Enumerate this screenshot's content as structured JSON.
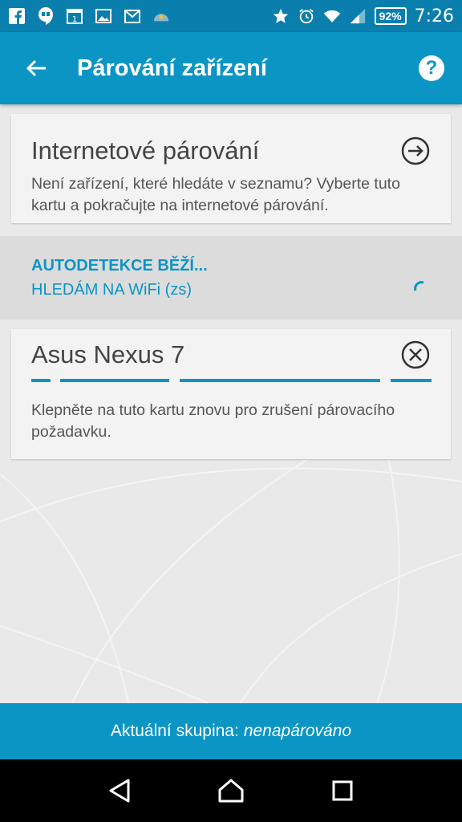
{
  "status_bar": {
    "time": "7:26",
    "battery": "92%",
    "notification_icons": [
      "facebook-icon",
      "hangouts-icon",
      "calendar-icon",
      "gallery-icon",
      "gmail-icon",
      "weather-icon"
    ],
    "system_icons": [
      "star-icon",
      "alarm-icon",
      "wifi-icon",
      "signal-icon"
    ]
  },
  "app_bar": {
    "title": "Párování zařízení",
    "help_label": "?"
  },
  "internet_card": {
    "title": "Internetové párování",
    "description": "Není zařízení, které hledáte v seznamu? Vyberte tuto kartu a pokračujte na internetové párování."
  },
  "autodetect": {
    "title": "AUTODETEKCE BĚŽÍ...",
    "subtitle": "HLEDÁM NA WiFi (zs)"
  },
  "device_card": {
    "title": "Asus Nexus 7",
    "description": "Klepněte na tuto kartu znovu pro zrušení párovacího požadavku."
  },
  "bottom_bar": {
    "label": "Aktuální skupina:",
    "value": "nenapárováno"
  },
  "colors": {
    "accent": "#0b95c5",
    "status_bar": "#0a7fae",
    "background": "#e9e9e9",
    "card": "#f3f3f3"
  }
}
